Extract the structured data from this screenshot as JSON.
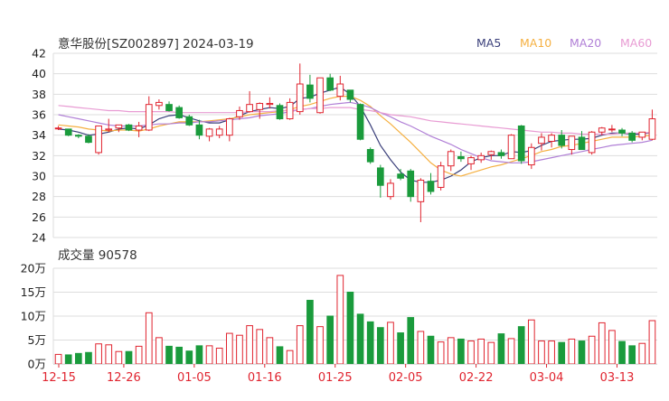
{
  "title": "意华股份[SZ002897] 2024-03-19",
  "legend": [
    {
      "label": "MA5",
      "color": "#3a3f7a"
    },
    {
      "label": "MA10",
      "color": "#f5b041"
    },
    {
      "label": "MA20",
      "color": "#b07fd6"
    },
    {
      "label": "MA60",
      "color": "#e89bd3"
    }
  ],
  "volume_label": "成交量 90578",
  "colors": {
    "up": "#e0242f",
    "down": "#1a9b3c",
    "grid": "#dddddd",
    "axis": "#222222",
    "date_text": "#e0242f"
  },
  "chart_data": [
    {
      "type": "candlestick",
      "title": "意华股份[SZ002897] 2024-03-19",
      "ylim": [
        24,
        42
      ],
      "yticks": [
        "42",
        "40",
        "38",
        "36",
        "34",
        "32",
        "30",
        "28",
        "26",
        "24"
      ],
      "xticks": [
        {
          "label": "12-15",
          "index": 0
        },
        {
          "label": "12-26",
          "index": 7
        },
        {
          "label": "01-05",
          "index": 14
        },
        {
          "label": "01-16",
          "index": 21
        },
        {
          "label": "01-25",
          "index": 28
        },
        {
          "label": "02-05",
          "index": 35
        },
        {
          "label": "02-22",
          "index": 42
        },
        {
          "label": "03-04",
          "index": 49
        },
        {
          "label": "03-13",
          "index": 56
        }
      ],
      "candles": [
        [
          34.7,
          34.9,
          34.5,
          34.7
        ],
        [
          34.6,
          34.6,
          33.9,
          34.0
        ],
        [
          34.0,
          34.1,
          33.7,
          33.9
        ],
        [
          33.9,
          34.1,
          33.2,
          33.3
        ],
        [
          32.3,
          34.9,
          32.1,
          34.9
        ],
        [
          34.5,
          35.6,
          34.3,
          34.6
        ],
        [
          34.7,
          35.0,
          34.3,
          35.0
        ],
        [
          35.0,
          35.1,
          34.4,
          34.5
        ],
        [
          34.5,
          35.3,
          33.8,
          34.9
        ],
        [
          34.5,
          37.8,
          34.4,
          37.0
        ],
        [
          36.9,
          37.5,
          36.5,
          37.2
        ],
        [
          37.0,
          37.3,
          36.3,
          36.4
        ],
        [
          36.7,
          36.9,
          35.6,
          35.7
        ],
        [
          35.8,
          36.0,
          34.9,
          35.0
        ],
        [
          35.0,
          35.5,
          33.6,
          34.0
        ],
        [
          33.9,
          34.7,
          33.4,
          34.6
        ],
        [
          34.0,
          34.9,
          33.7,
          34.6
        ],
        [
          34.0,
          35.7,
          33.4,
          35.6
        ],
        [
          35.8,
          36.8,
          35.5,
          36.4
        ],
        [
          36.3,
          38.3,
          36.2,
          37.0
        ],
        [
          36.5,
          37.2,
          35.6,
          37.1
        ],
        [
          37.0,
          37.7,
          36.6,
          37.1
        ],
        [
          36.9,
          37.1,
          35.5,
          35.6
        ],
        [
          35.6,
          37.6,
          35.5,
          37.2
        ],
        [
          36.3,
          41.0,
          36.0,
          39.0
        ],
        [
          38.9,
          39.9,
          37.2,
          37.6
        ],
        [
          36.2,
          39.0,
          36.1,
          39.6
        ],
        [
          39.6,
          40.0,
          38.3,
          38.4
        ],
        [
          37.8,
          39.8,
          37.4,
          39.0
        ],
        [
          38.4,
          38.4,
          37.2,
          37.5
        ],
        [
          37.0,
          37.1,
          33.5,
          33.6
        ],
        [
          32.6,
          32.8,
          31.2,
          31.4
        ],
        [
          30.8,
          31.1,
          27.9,
          29.1
        ],
        [
          28.0,
          29.7,
          27.7,
          29.3
        ],
        [
          30.2,
          30.7,
          29.6,
          29.8
        ],
        [
          30.5,
          30.7,
          27.5,
          28.0
        ],
        [
          27.5,
          29.8,
          25.5,
          29.6
        ],
        [
          29.5,
          30.3,
          28.2,
          28.5
        ],
        [
          28.9,
          31.4,
          28.6,
          31.0
        ],
        [
          31.0,
          32.6,
          30.5,
          32.4
        ],
        [
          31.9,
          32.4,
          31.4,
          31.7
        ],
        [
          31.2,
          32.0,
          30.6,
          31.8
        ],
        [
          31.6,
          32.3,
          31.3,
          32.0
        ],
        [
          32.1,
          32.5,
          31.6,
          32.4
        ],
        [
          32.3,
          32.6,
          31.7,
          32.0
        ],
        [
          31.7,
          34.1,
          31.7,
          34.0
        ],
        [
          34.9,
          35.0,
          31.2,
          31.5
        ],
        [
          31.1,
          33.2,
          30.7,
          32.8
        ],
        [
          33.2,
          34.2,
          32.5,
          33.8
        ],
        [
          33.4,
          34.2,
          32.8,
          34.0
        ],
        [
          34.0,
          34.5,
          32.7,
          33.0
        ],
        [
          32.6,
          33.8,
          32.1,
          33.9
        ],
        [
          33.8,
          34.4,
          32.9,
          32.6
        ],
        [
          32.3,
          34.4,
          32.1,
          34.3
        ],
        [
          34.3,
          34.8,
          34.0,
          34.7
        ],
        [
          34.6,
          35.0,
          34.3,
          34.6
        ],
        [
          34.5,
          34.7,
          33.9,
          34.2
        ],
        [
          34.2,
          34.4,
          33.3,
          33.5
        ],
        [
          33.8,
          34.1,
          33.5,
          34.3
        ],
        [
          33.6,
          36.5,
          33.5,
          35.6
        ]
      ],
      "series": [
        {
          "name": "MA5",
          "values": [
            34.6,
            34.5,
            34.3,
            34.0,
            34.1,
            34.3,
            34.6,
            34.7,
            34.6,
            35.0,
            35.6,
            35.9,
            36.0,
            35.7,
            35.4,
            35.2,
            35.2,
            35.5,
            35.9,
            36.3,
            36.5,
            36.7,
            36.6,
            36.8,
            37.6,
            37.7,
            38.1,
            38.4,
            38.7,
            38.0,
            36.8,
            35.0,
            33.0,
            31.6,
            30.4,
            29.6,
            29.4,
            29.4,
            29.6,
            30.0,
            30.6,
            31.4,
            31.8,
            32.0,
            32.0,
            32.4,
            32.3,
            32.5,
            33.0,
            33.4,
            33.5,
            33.6,
            33.6,
            33.7,
            34.0,
            34.2,
            34.2,
            34.1,
            34.1,
            34.3
          ]
        },
        {
          "name": "MA10",
          "values": [
            35.0,
            34.9,
            34.8,
            34.6,
            34.5,
            34.4,
            34.5,
            34.5,
            34.4,
            34.6,
            34.9,
            35.1,
            35.3,
            35.3,
            35.3,
            35.4,
            35.5,
            35.6,
            35.8,
            36.0,
            36.1,
            36.2,
            36.3,
            36.5,
            36.8,
            37.0,
            37.3,
            37.6,
            37.8,
            37.8,
            37.4,
            36.8,
            35.9,
            35.1,
            34.2,
            33.3,
            32.3,
            31.3,
            30.6,
            30.2,
            30.0,
            30.3,
            30.6,
            30.9,
            31.1,
            31.4,
            31.7,
            32.0,
            32.4,
            32.6,
            32.9,
            33.0,
            33.2,
            33.4,
            33.6,
            33.8,
            33.8,
            33.8,
            33.9,
            34.0
          ]
        },
        {
          "name": "MA20",
          "values": [
            36.0,
            35.8,
            35.6,
            35.4,
            35.2,
            35.0,
            34.9,
            34.9,
            34.9,
            35.0,
            35.1,
            35.1,
            35.2,
            35.2,
            35.3,
            35.3,
            35.4,
            35.5,
            35.6,
            35.7,
            35.9,
            36.0,
            36.1,
            36.3,
            36.5,
            36.6,
            36.8,
            37.0,
            37.1,
            37.2,
            37.0,
            36.7,
            36.2,
            35.8,
            35.3,
            34.9,
            34.4,
            33.9,
            33.5,
            33.1,
            32.6,
            32.2,
            31.8,
            31.5,
            31.4,
            31.3,
            31.3,
            31.4,
            31.6,
            31.8,
            32.0,
            32.2,
            32.4,
            32.6,
            32.8,
            33.0,
            33.1,
            33.2,
            33.3,
            33.5
          ]
        },
        {
          "name": "MA60",
          "values": [
            36.9,
            36.8,
            36.7,
            36.6,
            36.5,
            36.4,
            36.4,
            36.3,
            36.3,
            36.3,
            36.3,
            36.3,
            36.2,
            36.2,
            36.2,
            36.2,
            36.2,
            36.2,
            36.2,
            36.3,
            36.3,
            36.3,
            36.4,
            36.4,
            36.5,
            36.6,
            36.6,
            36.7,
            36.7,
            36.7,
            36.5,
            36.4,
            36.2,
            36.0,
            35.9,
            35.8,
            35.6,
            35.4,
            35.3,
            35.2,
            35.1,
            35.0,
            34.9,
            34.8,
            34.7,
            34.6,
            34.5,
            34.4,
            34.3,
            34.3,
            34.2,
            34.2,
            34.1,
            34.1,
            34.1,
            34.1,
            34.2,
            34.2,
            34.2,
            34.3
          ]
        }
      ]
    },
    {
      "type": "bar",
      "title": "成交量 90578",
      "ylim": [
        0,
        200000
      ],
      "yticks": [
        "20万",
        "15万",
        "10万",
        "5万",
        "0万"
      ],
      "values": [
        20000,
        19000,
        22000,
        24000,
        42000,
        40000,
        26000,
        26000,
        37000,
        107000,
        55000,
        37000,
        35000,
        27000,
        38000,
        38000,
        33000,
        64000,
        60000,
        80000,
        72000,
        55000,
        36000,
        28000,
        80000,
        133000,
        78000,
        100000,
        185000,
        150000,
        104000,
        88000,
        76000,
        87000,
        65000,
        97000,
        68000,
        58000,
        46000,
        55000,
        52000,
        48000,
        52000,
        45000,
        63000,
        53000,
        78000,
        92000,
        48000,
        48000,
        45000,
        52000,
        48000,
        58000,
        86000,
        70000,
        47000,
        38000,
        43000,
        90578
      ]
    }
  ]
}
